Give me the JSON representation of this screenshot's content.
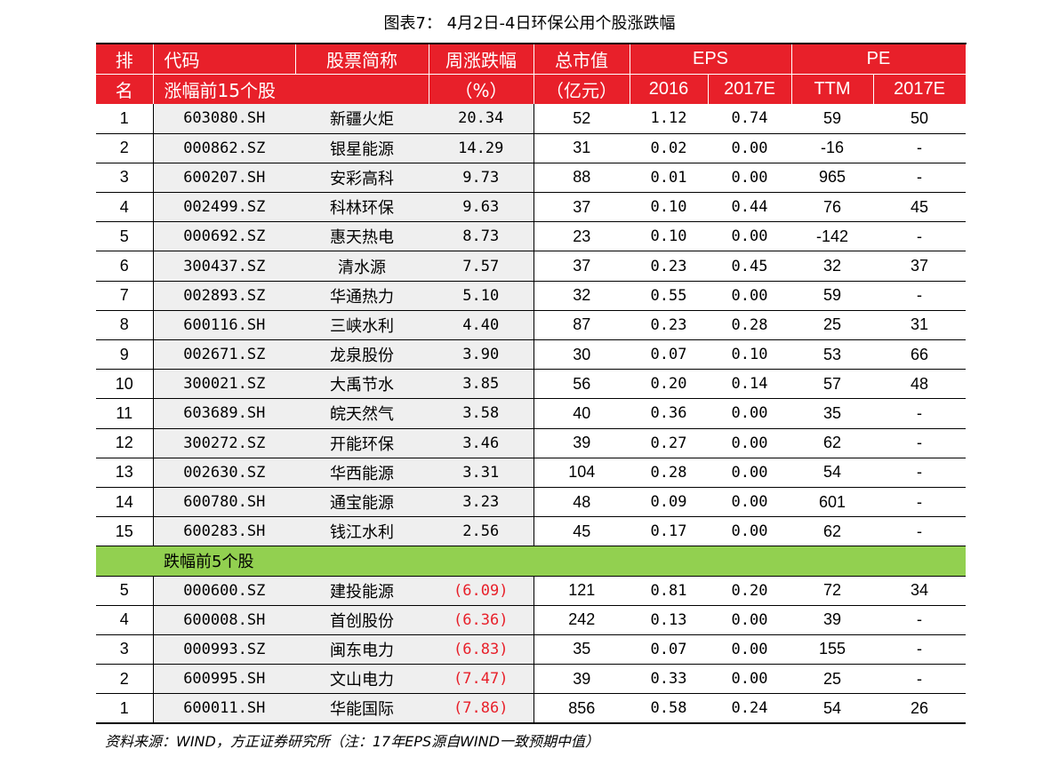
{
  "caption": "图表7： 4月2日-4日环保公用个股涨跌幅",
  "header": {
    "rank_top": "排",
    "rank_bottom": "名",
    "code": "代码",
    "name": "股票简称",
    "change": "周涨跌幅",
    "mcap": "总市值",
    "eps": "EPS",
    "pe": "PE",
    "gainers_label": "涨幅前15个股",
    "change_unit": "（%）",
    "mcap_unit": "（亿元）",
    "eps_2016": "2016",
    "eps_2017e": "2017E",
    "pe_ttm": "TTM",
    "pe_2017e": "2017E"
  },
  "colors": {
    "header_bg": "#e8202a",
    "section_bg": "#92d050",
    "negative": "#e8202a",
    "grey_col": "#efefef"
  },
  "gainers": [
    {
      "rank": "1",
      "code": "603080.SH",
      "name": "新疆火炬",
      "change": "20.34",
      "mcap": "52",
      "eps2016": "1.12",
      "eps2017": "0.74",
      "pettm": "59",
      "pe2017": "50"
    },
    {
      "rank": "2",
      "code": "000862.SZ",
      "name": "银星能源",
      "change": "14.29",
      "mcap": "31",
      "eps2016": "0.02",
      "eps2017": "0.00",
      "pettm": "-16",
      "pe2017": "-"
    },
    {
      "rank": "3",
      "code": "600207.SH",
      "name": "安彩高科",
      "change": "9.73",
      "mcap": "88",
      "eps2016": "0.01",
      "eps2017": "0.00",
      "pettm": "965",
      "pe2017": "-"
    },
    {
      "rank": "4",
      "code": "002499.SZ",
      "name": "科林环保",
      "change": "9.63",
      "mcap": "37",
      "eps2016": "0.10",
      "eps2017": "0.44",
      "pettm": "76",
      "pe2017": "45"
    },
    {
      "rank": "5",
      "code": "000692.SZ",
      "name": "惠天热电",
      "change": "8.73",
      "mcap": "23",
      "eps2016": "0.10",
      "eps2017": "0.00",
      "pettm": "-142",
      "pe2017": "-"
    },
    {
      "rank": "6",
      "code": "300437.SZ",
      "name": "清水源",
      "change": "7.57",
      "mcap": "37",
      "eps2016": "0.23",
      "eps2017": "0.45",
      "pettm": "32",
      "pe2017": "37"
    },
    {
      "rank": "7",
      "code": "002893.SZ",
      "name": "华通热力",
      "change": "5.10",
      "mcap": "32",
      "eps2016": "0.55",
      "eps2017": "0.00",
      "pettm": "59",
      "pe2017": "-"
    },
    {
      "rank": "8",
      "code": "600116.SH",
      "name": "三峡水利",
      "change": "4.40",
      "mcap": "87",
      "eps2016": "0.23",
      "eps2017": "0.28",
      "pettm": "25",
      "pe2017": "31"
    },
    {
      "rank": "9",
      "code": "002671.SZ",
      "name": "龙泉股份",
      "change": "3.90",
      "mcap": "30",
      "eps2016": "0.07",
      "eps2017": "0.10",
      "pettm": "53",
      "pe2017": "66"
    },
    {
      "rank": "10",
      "code": "300021.SZ",
      "name": "大禹节水",
      "change": "3.85",
      "mcap": "56",
      "eps2016": "0.20",
      "eps2017": "0.14",
      "pettm": "57",
      "pe2017": "48"
    },
    {
      "rank": "11",
      "code": "603689.SH",
      "name": "皖天然气",
      "change": "3.58",
      "mcap": "40",
      "eps2016": "0.36",
      "eps2017": "0.00",
      "pettm": "35",
      "pe2017": "-"
    },
    {
      "rank": "12",
      "code": "300272.SZ",
      "name": "开能环保",
      "change": "3.46",
      "mcap": "39",
      "eps2016": "0.27",
      "eps2017": "0.00",
      "pettm": "62",
      "pe2017": "-"
    },
    {
      "rank": "13",
      "code": "002630.SZ",
      "name": "华西能源",
      "change": "3.31",
      "mcap": "104",
      "eps2016": "0.28",
      "eps2017": "0.00",
      "pettm": "54",
      "pe2017": "-"
    },
    {
      "rank": "14",
      "code": "600780.SH",
      "name": "通宝能源",
      "change": "3.23",
      "mcap": "48",
      "eps2016": "0.09",
      "eps2017": "0.00",
      "pettm": "601",
      "pe2017": "-"
    },
    {
      "rank": "15",
      "code": "600283.SH",
      "name": "钱江水利",
      "change": "2.56",
      "mcap": "45",
      "eps2016": "0.17",
      "eps2017": "0.00",
      "pettm": "62",
      "pe2017": "-"
    }
  ],
  "losers_label": "跌幅前5个股",
  "losers": [
    {
      "rank": "5",
      "code": "000600.SZ",
      "name": "建投能源",
      "change": "(6.09)",
      "mcap": "121",
      "eps2016": "0.81",
      "eps2017": "0.20",
      "pettm": "72",
      "pe2017": "34"
    },
    {
      "rank": "4",
      "code": "600008.SH",
      "name": "首创股份",
      "change": "(6.36)",
      "mcap": "242",
      "eps2016": "0.13",
      "eps2017": "0.00",
      "pettm": "39",
      "pe2017": "-"
    },
    {
      "rank": "3",
      "code": "000993.SZ",
      "name": "闽东电力",
      "change": "(6.83)",
      "mcap": "35",
      "eps2016": "0.07",
      "eps2017": "0.00",
      "pettm": "155",
      "pe2017": "-"
    },
    {
      "rank": "2",
      "code": "600995.SH",
      "name": "文山电力",
      "change": "(7.47)",
      "mcap": "39",
      "eps2016": "0.33",
      "eps2017": "0.00",
      "pettm": "25",
      "pe2017": "-"
    },
    {
      "rank": "1",
      "code": "600011.SH",
      "name": "华能国际",
      "change": "(7.86)",
      "mcap": "856",
      "eps2016": "0.58",
      "eps2017": "0.24",
      "pettm": "54",
      "pe2017": "26"
    }
  ],
  "source": "资料来源：WIND，方正证券研究所（注：17年EPS源自WIND一致预期中值）"
}
